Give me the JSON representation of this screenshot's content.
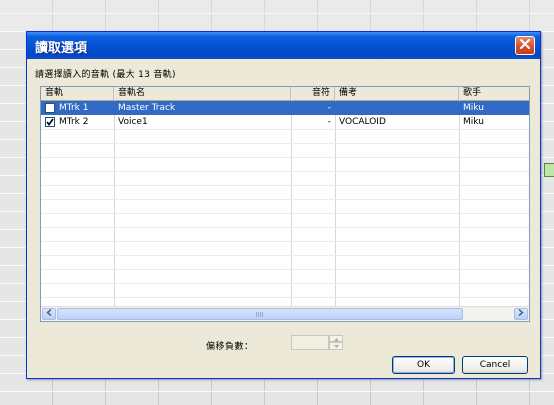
{
  "dialog": {
    "title": "讀取選項",
    "prompt": "請選擇讀入的音軌 (最大 13 音軌)"
  },
  "columns": [
    "音軌",
    "音軌名",
    "音符",
    "備考",
    "歌手"
  ],
  "rows": [
    {
      "checked": false,
      "track": "MTrk 1",
      "name": "Master Track",
      "notes": "-",
      "note": "",
      "singer": "Miku",
      "selected": true
    },
    {
      "checked": true,
      "track": "MTrk 2",
      "name": "Voice1",
      "notes": "-",
      "note": "VOCALOID",
      "singer": "Miku",
      "selected": false
    }
  ],
  "offset": {
    "label": "偏移負數：",
    "value": ""
  },
  "buttons": {
    "ok": "OK",
    "cancel": "Cancel"
  },
  "icons": {
    "close": "close-icon",
    "check": "checkmark-icon",
    "scroll_left": "arrow-left-icon",
    "scroll_right": "arrow-right-icon",
    "spin_up": "spin-up-icon",
    "spin_down": "spin-down-icon"
  }
}
